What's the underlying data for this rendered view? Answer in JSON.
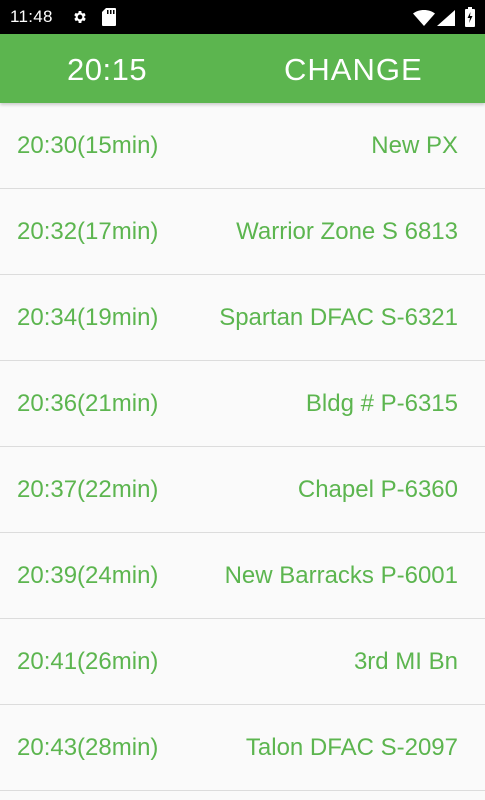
{
  "status_bar": {
    "time": "11:48",
    "icons": [
      "gear-icon",
      "sd-card-icon",
      "wifi-icon",
      "signal-icon",
      "battery-icon"
    ]
  },
  "toolbar": {
    "time": "20:15",
    "change_label": "CHANGE",
    "color": "#5cb54f"
  },
  "stops": [
    {
      "time": "20:30(15min)",
      "name": "New PX"
    },
    {
      "time": "20:32(17min)",
      "name": "Warrior Zone S 6813"
    },
    {
      "time": "20:34(19min)",
      "name": "Spartan DFAC S-6321"
    },
    {
      "time": "20:36(21min)",
      "name": "Bldg # P-6315"
    },
    {
      "time": "20:37(22min)",
      "name": "Chapel P-6360"
    },
    {
      "time": "20:39(24min)",
      "name": "New Barracks P-6001"
    },
    {
      "time": "20:41(26min)",
      "name": "3rd MI Bn"
    },
    {
      "time": "20:43(28min)",
      "name": "Talon DFAC S-2097"
    }
  ],
  "colors": {
    "accent": "#5cb54f",
    "status_bar": "#000000",
    "background": "#fafafa",
    "divider": "#dcdcdc"
  }
}
